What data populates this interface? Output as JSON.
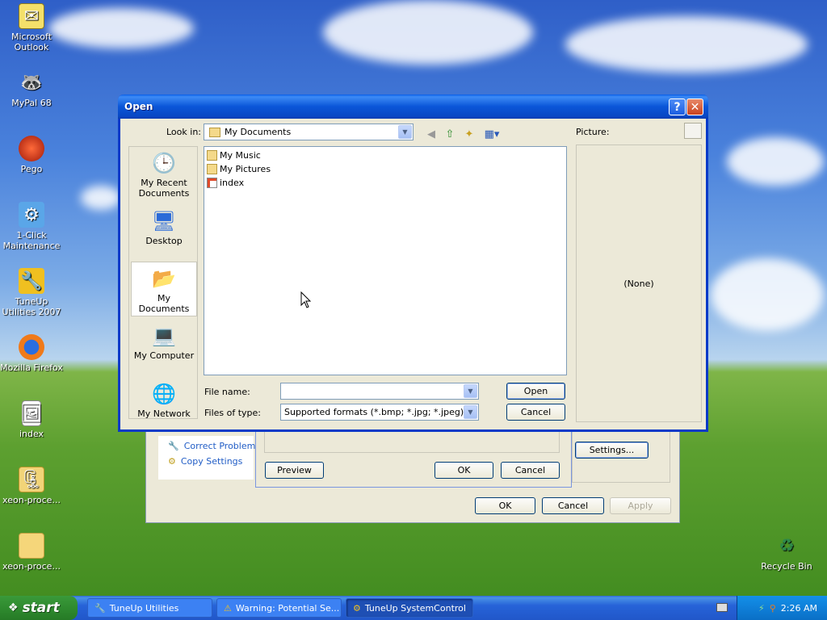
{
  "desktop": {
    "icons": [
      {
        "label": "Microsoft Outlook",
        "icon": "outlook-icon"
      },
      {
        "label": "MyPal 68",
        "icon": "mypal-icon"
      },
      {
        "label": "Pego",
        "icon": "pego-icon"
      },
      {
        "label": "1-Click Maintenance",
        "icon": "maintenance-icon"
      },
      {
        "label": "TuneUp Utilities 2007",
        "icon": "tuneup-icon"
      },
      {
        "label": "Mozilla Firefox",
        "icon": "firefox-icon"
      },
      {
        "label": "index",
        "icon": "image-file-icon"
      },
      {
        "label": "xeon-proce...",
        "icon": "zip-folder-icon"
      },
      {
        "label": "xeon-proce...",
        "icon": "folder-icon"
      },
      {
        "label": "Recycle Bin",
        "icon": "recycle-bin-icon"
      }
    ]
  },
  "back_window": {
    "tasks": [
      "Correct Problems",
      "Copy Settings"
    ],
    "buttons": {
      "preview": "Preview",
      "ok_inner": "OK",
      "cancel_inner": "Cancel",
      "settings": "Settings...",
      "ok": "OK",
      "cancel": "Cancel",
      "apply": "Apply"
    }
  },
  "dialog": {
    "title": "Open",
    "look_in_label": "Look in:",
    "look_in_value": "My Documents",
    "picture_label": "Picture:",
    "preview_text": "(None)",
    "places": [
      "My Recent Documents",
      "Desktop",
      "My Documents",
      "My Computer",
      "My Network"
    ],
    "files": [
      {
        "name": "My Music",
        "icon": "music-folder-icon"
      },
      {
        "name": "My Pictures",
        "icon": "pictures-folder-icon"
      },
      {
        "name": "index",
        "icon": "image-file-icon"
      }
    ],
    "file_name_label": "File name:",
    "file_name_value": "",
    "files_of_type_label": "Files of type:",
    "files_of_type_value": "Supported formats (*.bmp; *.jpg; *.jpeg)",
    "open_button": "Open",
    "cancel_button": "Cancel"
  },
  "taskbar": {
    "start_label": "start",
    "tasks": [
      "TuneUp Utilities",
      "Warning: Potential Se...",
      "TuneUp SystemControl"
    ],
    "clock": "2:26 AM"
  }
}
